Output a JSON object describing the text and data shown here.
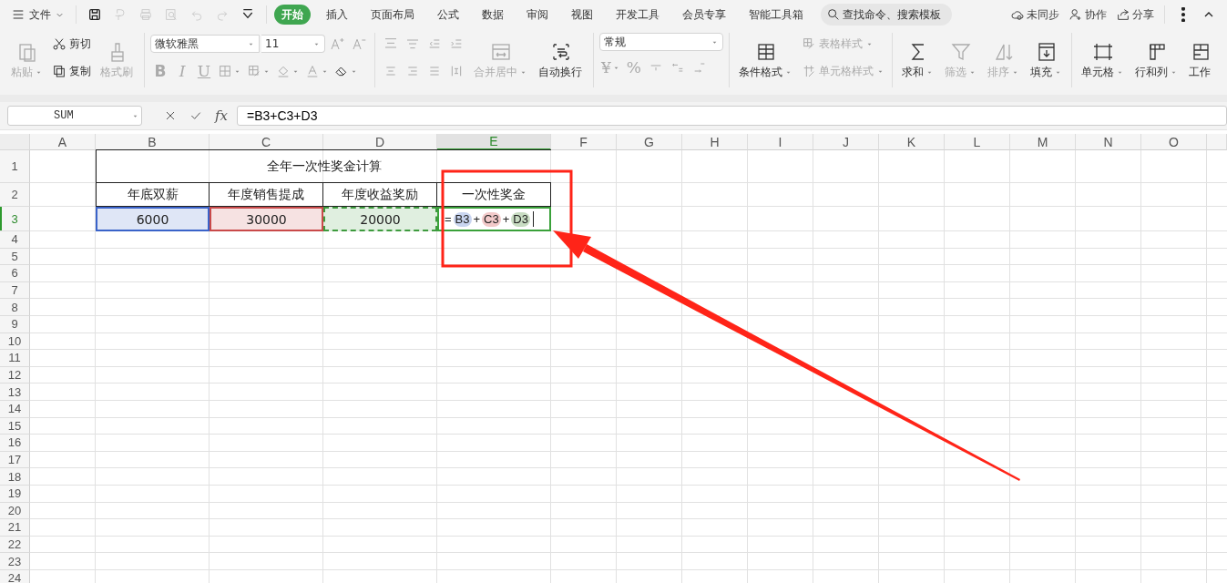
{
  "menu": {
    "label": "文件"
  },
  "quick_access": [
    {
      "disabled": false
    },
    {
      "disabled": true
    },
    {
      "disabled": true
    },
    {
      "disabled": true
    },
    {
      "disabled": true
    },
    {
      "disabled": true
    },
    {
      "disabled": false
    }
  ],
  "tabs": [
    {
      "label": "开始",
      "selected": true
    },
    {
      "label": "插入",
      "selected": false
    },
    {
      "label": "页面布局",
      "selected": false
    },
    {
      "label": "公式",
      "selected": false
    },
    {
      "label": "数据",
      "selected": false
    },
    {
      "label": "审阅",
      "selected": false
    },
    {
      "label": "视图",
      "selected": false
    },
    {
      "label": "开发工具",
      "selected": false
    },
    {
      "label": "会员专享",
      "selected": false
    },
    {
      "label": "智能工具箱",
      "selected": false
    }
  ],
  "search": {
    "placeholder": "查找命令、搜索模板"
  },
  "actions": [
    {
      "label": "未同步"
    },
    {
      "label": "协作"
    },
    {
      "label": "分享"
    }
  ],
  "ribbon": {
    "groups": [
      {
        "items": [
          {
            "label": "粘贴",
            "disabled": true,
            "dropdown": true
          },
          {
            "label": "剪切",
            "disabled": false
          },
          {
            "label": "复制",
            "disabled": false
          },
          {
            "label": "格式刷",
            "disabled": true
          }
        ]
      },
      {
        "font": "微软雅黑",
        "size": "11",
        "items": [
          {
            "disabled": true
          },
          {
            "disabled": true
          },
          {
            "label": "B",
            "disabled": true
          },
          {
            "label": "I",
            "disabled": true
          },
          {
            "label": "U",
            "disabled": true
          },
          {
            "disabled": true,
            "dropdown": true
          },
          {
            "disabled": true,
            "dropdown": true
          },
          {
            "disabled": true,
            "dropdown": true
          },
          {
            "disabled": true,
            "dropdown": true
          },
          {
            "disabled": false,
            "dropdown": true
          }
        ]
      },
      {
        "items": [
          {
            "disabled": true
          },
          {
            "disabled": true
          },
          {
            "disabled": true
          },
          {
            "disabled": true
          },
          {
            "disabled": true
          },
          {
            "disabled": true
          },
          {
            "disabled": true
          },
          {
            "disabled": true
          },
          {
            "label": "合并居中",
            "disabled": true,
            "dropdown": true
          },
          {
            "label": "自动换行",
            "disabled": false
          }
        ]
      },
      {
        "format": "常规",
        "items": [
          {
            "label": "¥",
            "disabled": true,
            "dropdown": true
          },
          {
            "label": "%",
            "disabled": true
          },
          {
            "disabled": true
          },
          {
            "disabled": true
          },
          {
            "disabled": true
          }
        ]
      },
      {
        "items": [
          {
            "label": "条件格式",
            "disabled": false,
            "dropdown": true
          },
          {
            "label": "表格样式",
            "disabled": true,
            "dropdown": true
          },
          {
            "label": "单元格样式",
            "disabled": true,
            "dropdown": true
          }
        ]
      },
      {
        "items": [
          {
            "label": "求和",
            "disabled": false,
            "dropdown": true
          },
          {
            "label": "筛选",
            "disabled": true,
            "dropdown": true
          },
          {
            "label": "排序",
            "disabled": true,
            "dropdown": true
          },
          {
            "label": "填充",
            "disabled": false,
            "dropdown": true
          }
        ]
      },
      {
        "items": [
          {
            "label": "单元格",
            "disabled": false,
            "dropdown": true
          },
          {
            "label": "行和列",
            "disabled": false,
            "dropdown": true
          },
          {
            "label": "工作",
            "disabled": false
          }
        ]
      }
    ]
  },
  "formula_bar": {
    "name_box": "SUM",
    "fx": "fx",
    "formula": "=B3+C3+D3"
  },
  "sheet": {
    "columns": [
      {
        "label": "A",
        "selected": false
      },
      {
        "label": "B",
        "selected": false
      },
      {
        "label": "C",
        "selected": false
      },
      {
        "label": "D",
        "selected": false
      },
      {
        "label": "E",
        "selected": true
      },
      {
        "label": "F",
        "selected": false
      },
      {
        "label": "G",
        "selected": false
      },
      {
        "label": "H",
        "selected": false
      },
      {
        "label": "I",
        "selected": false
      },
      {
        "label": "J",
        "selected": false
      },
      {
        "label": "K",
        "selected": false
      },
      {
        "label": "L",
        "selected": false
      },
      {
        "label": "M",
        "selected": false
      },
      {
        "label": "N",
        "selected": false
      },
      {
        "label": "O",
        "selected": false
      }
    ],
    "rows": [
      {
        "label": "1",
        "selected": false
      },
      {
        "label": "2",
        "selected": false
      },
      {
        "label": "3",
        "selected": true
      },
      {
        "label": "4",
        "selected": false
      },
      {
        "label": "5",
        "selected": false
      },
      {
        "label": "6",
        "selected": false
      },
      {
        "label": "7",
        "selected": false
      },
      {
        "label": "8",
        "selected": false
      },
      {
        "label": "9",
        "selected": false
      },
      {
        "label": "10",
        "selected": false
      },
      {
        "label": "11",
        "selected": false
      },
      {
        "label": "12",
        "selected": false
      },
      {
        "label": "13",
        "selected": false
      },
      {
        "label": "14",
        "selected": false
      },
      {
        "label": "15",
        "selected": false
      },
      {
        "label": "16",
        "selected": false
      },
      {
        "label": "17",
        "selected": false
      },
      {
        "label": "18",
        "selected": false
      },
      {
        "label": "19",
        "selected": false
      },
      {
        "label": "20",
        "selected": false
      },
      {
        "label": "21",
        "selected": false
      },
      {
        "label": "22",
        "selected": false
      },
      {
        "label": "23",
        "selected": false
      },
      {
        "label": "24",
        "selected": false
      }
    ],
    "title": "全年一次性奖金计算",
    "headers": [
      "年底双薪",
      "年度销售提成",
      "年度收益奖励",
      "一次性奖金"
    ],
    "values": [
      {
        "text": "6000",
        "color": "#3a63c9",
        "dashed": false
      },
      {
        "text": "30000",
        "color": "#c94a4a",
        "dashed": false
      },
      {
        "text": "20000",
        "color": "#3d9a3d",
        "dashed": true
      }
    ],
    "editor": {
      "tokens": [
        {
          "kind": "operator",
          "text": "="
        },
        {
          "kind": "reference",
          "text": "B3",
          "color": "#c9d5f0"
        },
        {
          "kind": "operator",
          "text": "+"
        },
        {
          "kind": "reference",
          "text": "C3",
          "color": "#f2c9c9"
        },
        {
          "kind": "operator",
          "text": "+"
        },
        {
          "kind": "reference",
          "text": "D3",
          "color": "#c8dcc2"
        }
      ]
    }
  }
}
